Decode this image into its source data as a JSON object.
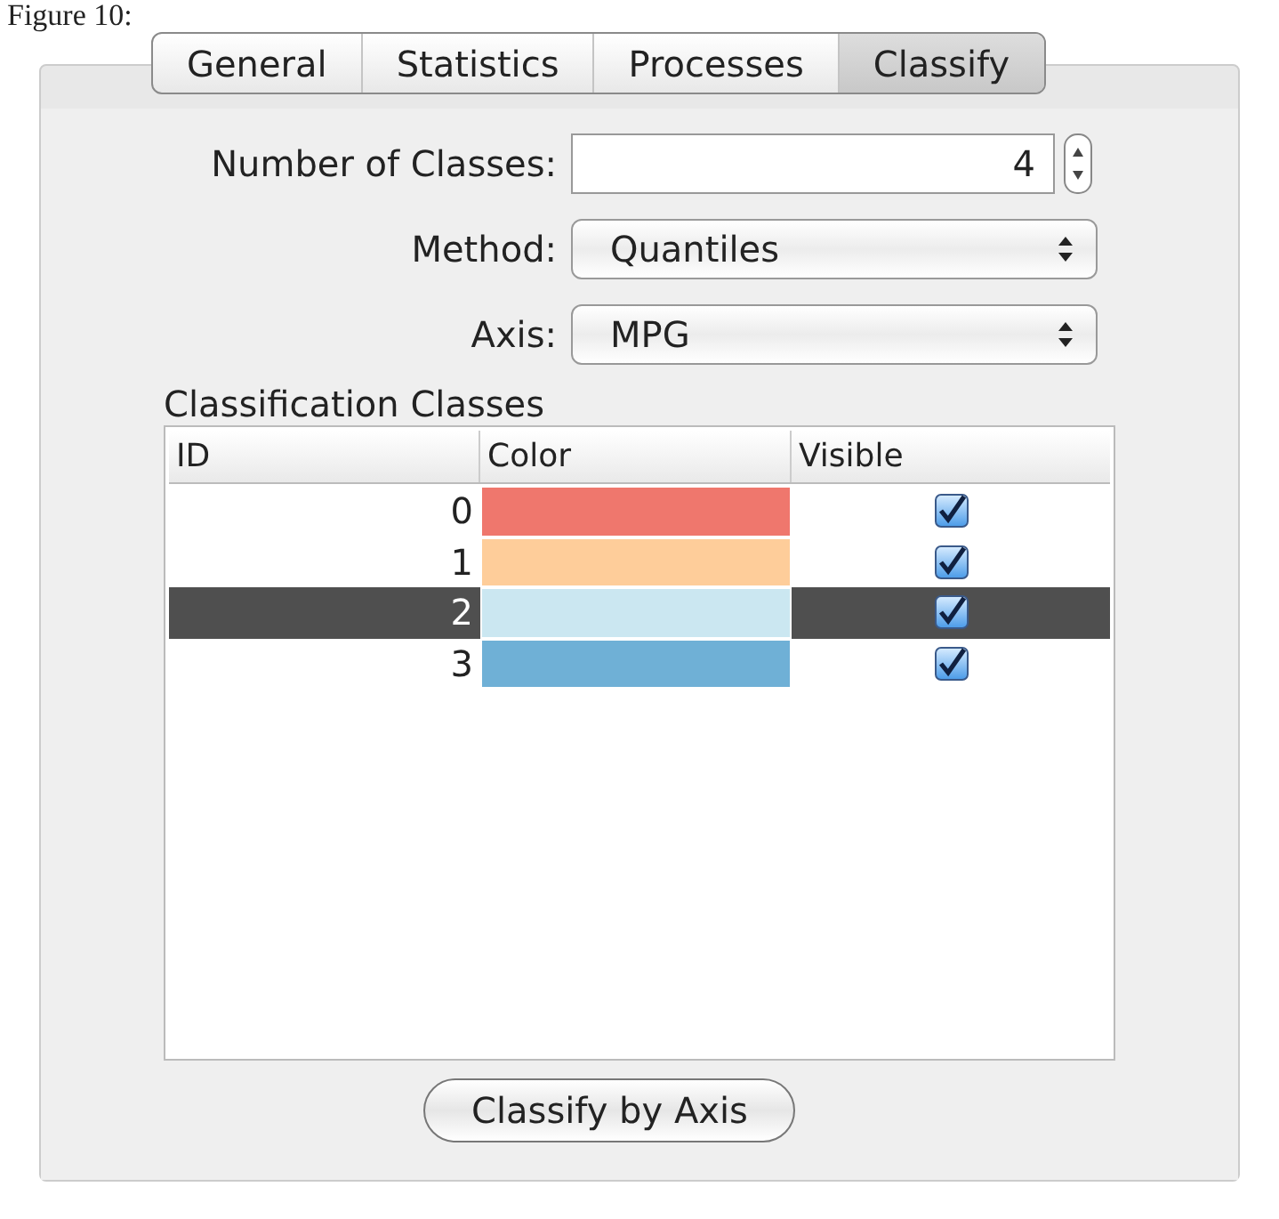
{
  "caption": "Figure 10:",
  "tabs": [
    {
      "label": "General",
      "selected": false
    },
    {
      "label": "Statistics",
      "selected": false
    },
    {
      "label": "Processes",
      "selected": false
    },
    {
      "label": "Classify",
      "selected": true
    }
  ],
  "number_of_classes": {
    "label": "Number of Classes:",
    "value": "4"
  },
  "method": {
    "label": "Method:",
    "value": "Quantiles"
  },
  "axis": {
    "label": "Axis:",
    "value": "MPG"
  },
  "classes_table": {
    "title": "Classification Classes",
    "columns": [
      "ID",
      "Color",
      "Visible"
    ],
    "rows": [
      {
        "id": "0",
        "color": "#ef776d",
        "visible": true,
        "selected": false
      },
      {
        "id": "1",
        "color": "#fecd9a",
        "visible": true,
        "selected": false
      },
      {
        "id": "2",
        "color": "#cbe7f1",
        "visible": true,
        "selected": true
      },
      {
        "id": "3",
        "color": "#6fb0d6",
        "visible": true,
        "selected": false
      }
    ]
  },
  "buttons": [
    "Classify by Axis"
  ]
}
